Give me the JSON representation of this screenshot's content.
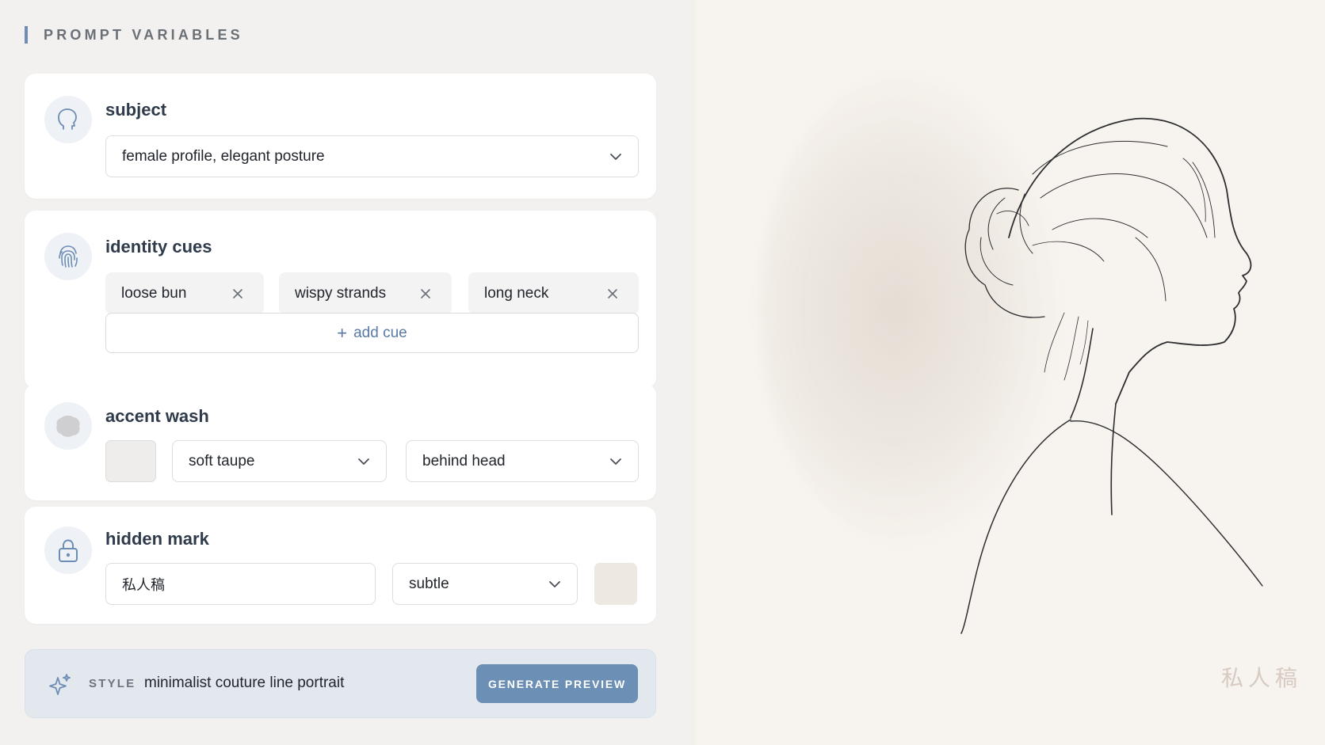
{
  "section_title": "PROMPT VARIABLES",
  "subject": {
    "title": "subject",
    "icon": "head-profile-icon",
    "value": "female profile, elegant posture"
  },
  "identity_cues": {
    "title": "identity cues",
    "icon": "fingerprint-icon",
    "chips": [
      "loose bun",
      "wispy strands",
      "long neck"
    ],
    "add_label": "add cue"
  },
  "accent_wash": {
    "title": "accent wash",
    "icon": "wash-blob-icon",
    "swatch_color": "#efedeb",
    "tone": "soft taupe",
    "placement": "behind head"
  },
  "hidden_mark": {
    "title": "hidden mark",
    "icon": "lock-icon",
    "text": "私人稿",
    "visibility": "subtle",
    "swatch_color": "#ede8e2"
  },
  "style": {
    "label": "STYLE",
    "value": "minimalist couture line portrait",
    "button": "GENERATE PREVIEW"
  },
  "preview": {
    "watermark": "私人稿",
    "accent_color": "#6c8fb6"
  }
}
